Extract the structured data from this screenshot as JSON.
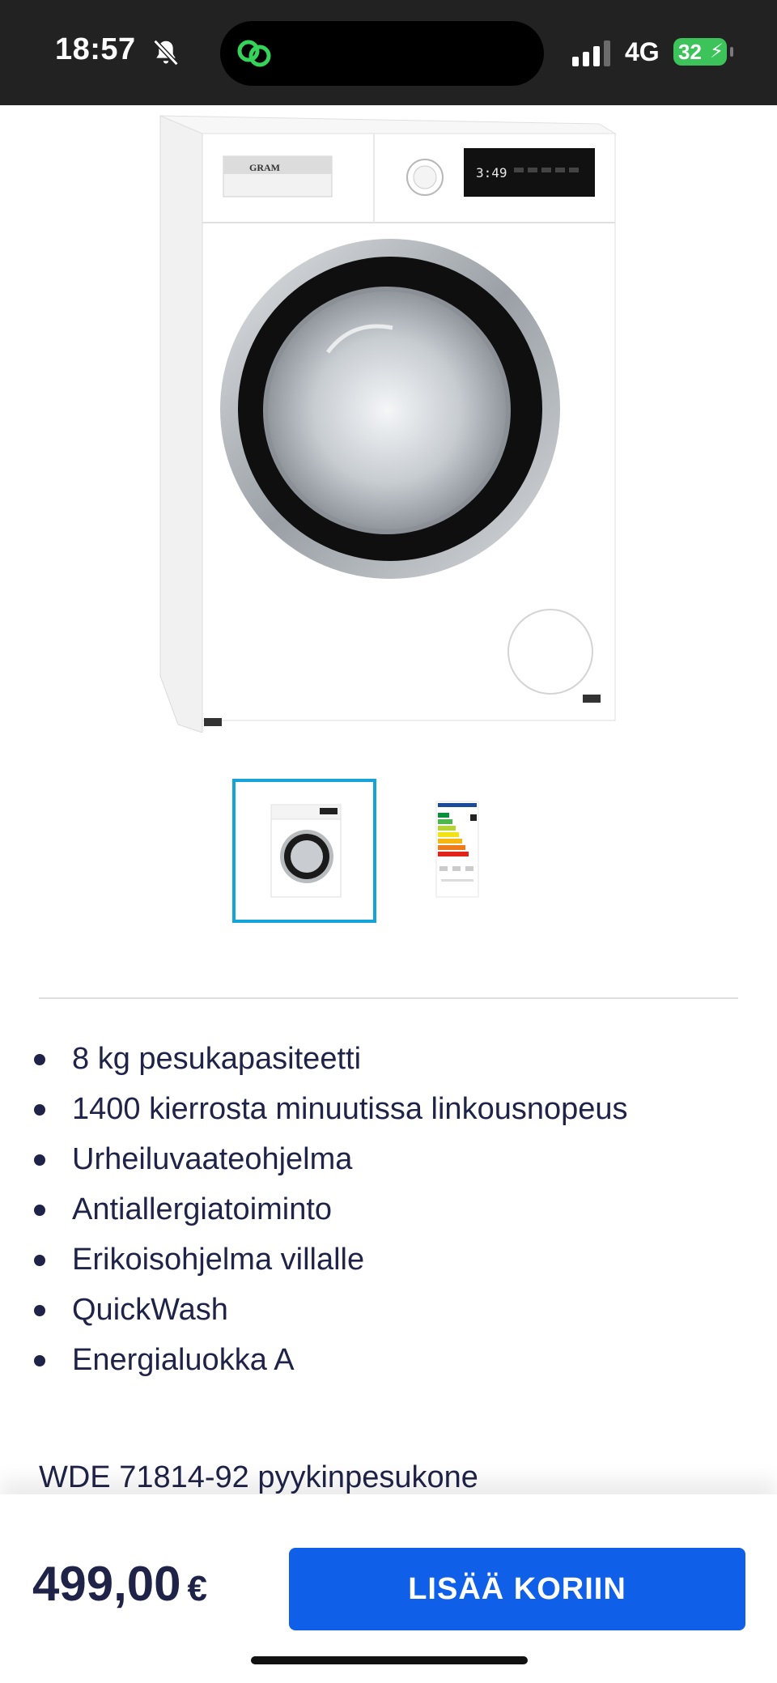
{
  "status_bar": {
    "time": "18:57",
    "network": "4G",
    "battery": "32",
    "icons": [
      "bell-slash-icon",
      "app-link-icon",
      "signal-icon",
      "battery-charging-icon"
    ]
  },
  "product": {
    "image": {
      "icon": "washing-machine-image",
      "brand": "GRAM",
      "display": "3:49"
    },
    "thumbnails": [
      {
        "icon": "washing-machine-thumbnail",
        "selected": true
      },
      {
        "icon": "energy-label-thumbnail",
        "selected": false
      }
    ],
    "features": [
      "8 kg pesukapasiteetti",
      "1400 kierrosta minuutissa linkousnopeus",
      "Urheiluvaateohjelma",
      "Antiallergiatoiminto",
      "Erikoisohjelma villalle",
      "QuickWash",
      "Energialuokka A"
    ],
    "name": "WDE 71814-92 pyykinpesukone"
  },
  "purchase": {
    "price": "499,00",
    "currency": "€",
    "add_to_cart_label": "LISÄÄ KORIIN"
  },
  "colors": {
    "status_bar_bg": "#222222",
    "text_navy": "#1f2347",
    "button_blue": "#0f5fe8",
    "thumb_selected_border": "#16a4d8",
    "battery_green": "#3cc35a"
  }
}
